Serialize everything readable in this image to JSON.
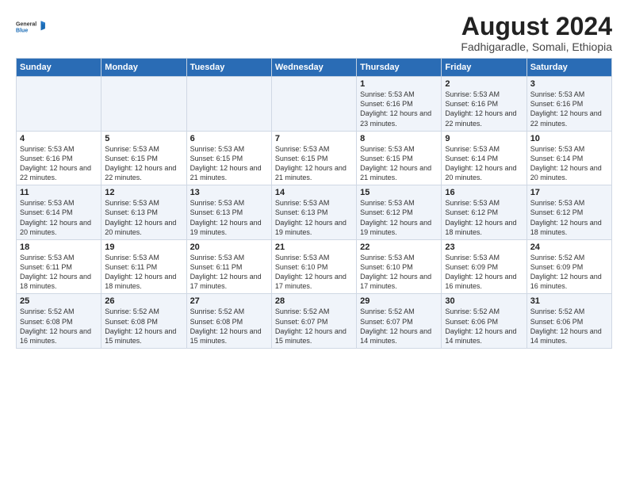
{
  "logo": {
    "general": "General",
    "blue": "Blue"
  },
  "title": "August 2024",
  "subtitle": "Fadhigaradle, Somali, Ethiopia",
  "days_of_week": [
    "Sunday",
    "Monday",
    "Tuesday",
    "Wednesday",
    "Thursday",
    "Friday",
    "Saturday"
  ],
  "weeks": [
    [
      {
        "num": "",
        "info": ""
      },
      {
        "num": "",
        "info": ""
      },
      {
        "num": "",
        "info": ""
      },
      {
        "num": "",
        "info": ""
      },
      {
        "num": "1",
        "info": "Sunrise: 5:53 AM\nSunset: 6:16 PM\nDaylight: 12 hours and 23 minutes."
      },
      {
        "num": "2",
        "info": "Sunrise: 5:53 AM\nSunset: 6:16 PM\nDaylight: 12 hours and 22 minutes."
      },
      {
        "num": "3",
        "info": "Sunrise: 5:53 AM\nSunset: 6:16 PM\nDaylight: 12 hours and 22 minutes."
      }
    ],
    [
      {
        "num": "4",
        "info": "Sunrise: 5:53 AM\nSunset: 6:16 PM\nDaylight: 12 hours and 22 minutes."
      },
      {
        "num": "5",
        "info": "Sunrise: 5:53 AM\nSunset: 6:15 PM\nDaylight: 12 hours and 22 minutes."
      },
      {
        "num": "6",
        "info": "Sunrise: 5:53 AM\nSunset: 6:15 PM\nDaylight: 12 hours and 21 minutes."
      },
      {
        "num": "7",
        "info": "Sunrise: 5:53 AM\nSunset: 6:15 PM\nDaylight: 12 hours and 21 minutes."
      },
      {
        "num": "8",
        "info": "Sunrise: 5:53 AM\nSunset: 6:15 PM\nDaylight: 12 hours and 21 minutes."
      },
      {
        "num": "9",
        "info": "Sunrise: 5:53 AM\nSunset: 6:14 PM\nDaylight: 12 hours and 20 minutes."
      },
      {
        "num": "10",
        "info": "Sunrise: 5:53 AM\nSunset: 6:14 PM\nDaylight: 12 hours and 20 minutes."
      }
    ],
    [
      {
        "num": "11",
        "info": "Sunrise: 5:53 AM\nSunset: 6:14 PM\nDaylight: 12 hours and 20 minutes."
      },
      {
        "num": "12",
        "info": "Sunrise: 5:53 AM\nSunset: 6:13 PM\nDaylight: 12 hours and 20 minutes."
      },
      {
        "num": "13",
        "info": "Sunrise: 5:53 AM\nSunset: 6:13 PM\nDaylight: 12 hours and 19 minutes."
      },
      {
        "num": "14",
        "info": "Sunrise: 5:53 AM\nSunset: 6:13 PM\nDaylight: 12 hours and 19 minutes."
      },
      {
        "num": "15",
        "info": "Sunrise: 5:53 AM\nSunset: 6:12 PM\nDaylight: 12 hours and 19 minutes."
      },
      {
        "num": "16",
        "info": "Sunrise: 5:53 AM\nSunset: 6:12 PM\nDaylight: 12 hours and 18 minutes."
      },
      {
        "num": "17",
        "info": "Sunrise: 5:53 AM\nSunset: 6:12 PM\nDaylight: 12 hours and 18 minutes."
      }
    ],
    [
      {
        "num": "18",
        "info": "Sunrise: 5:53 AM\nSunset: 6:11 PM\nDaylight: 12 hours and 18 minutes."
      },
      {
        "num": "19",
        "info": "Sunrise: 5:53 AM\nSunset: 6:11 PM\nDaylight: 12 hours and 18 minutes."
      },
      {
        "num": "20",
        "info": "Sunrise: 5:53 AM\nSunset: 6:11 PM\nDaylight: 12 hours and 17 minutes."
      },
      {
        "num": "21",
        "info": "Sunrise: 5:53 AM\nSunset: 6:10 PM\nDaylight: 12 hours and 17 minutes."
      },
      {
        "num": "22",
        "info": "Sunrise: 5:53 AM\nSunset: 6:10 PM\nDaylight: 12 hours and 17 minutes."
      },
      {
        "num": "23",
        "info": "Sunrise: 5:53 AM\nSunset: 6:09 PM\nDaylight: 12 hours and 16 minutes."
      },
      {
        "num": "24",
        "info": "Sunrise: 5:52 AM\nSunset: 6:09 PM\nDaylight: 12 hours and 16 minutes."
      }
    ],
    [
      {
        "num": "25",
        "info": "Sunrise: 5:52 AM\nSunset: 6:08 PM\nDaylight: 12 hours and 16 minutes."
      },
      {
        "num": "26",
        "info": "Sunrise: 5:52 AM\nSunset: 6:08 PM\nDaylight: 12 hours and 15 minutes."
      },
      {
        "num": "27",
        "info": "Sunrise: 5:52 AM\nSunset: 6:08 PM\nDaylight: 12 hours and 15 minutes."
      },
      {
        "num": "28",
        "info": "Sunrise: 5:52 AM\nSunset: 6:07 PM\nDaylight: 12 hours and 15 minutes."
      },
      {
        "num": "29",
        "info": "Sunrise: 5:52 AM\nSunset: 6:07 PM\nDaylight: 12 hours and 14 minutes."
      },
      {
        "num": "30",
        "info": "Sunrise: 5:52 AM\nSunset: 6:06 PM\nDaylight: 12 hours and 14 minutes."
      },
      {
        "num": "31",
        "info": "Sunrise: 5:52 AM\nSunset: 6:06 PM\nDaylight: 12 hours and 14 minutes."
      }
    ]
  ]
}
